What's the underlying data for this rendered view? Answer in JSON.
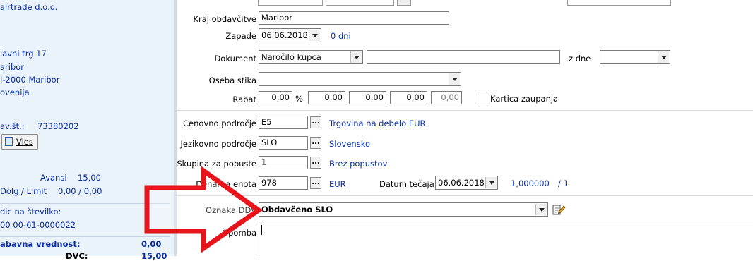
{
  "left": {
    "company": "airtrade d.o.o.",
    "street": "lavni trg 17",
    "city": "aribor",
    "postal": "I-2000  Maribor",
    "country": "ovenija",
    "tax_label": "av.št.:",
    "tax_value": "73380202",
    "vies_button": "Vies",
    "avansi_label": "Avansi",
    "avansi_value": "15,00",
    "dolg_label": "Dolg / Limit",
    "dolg_value": "0,00 / 0,00",
    "sklic_label": "dic na številko:",
    "sklic_value": "00 00-61-0000022",
    "davcna_label": "abavna vrednost:",
    "davcna_value": "0,00",
    "dvc_label": "DVC:",
    "dvc_value": "15,00"
  },
  "form": {
    "kraj_label": "Kraj obdavčitve",
    "kraj_value": "Maribor",
    "zapade_label": "Zapade",
    "zapade_value": "06.06.2018",
    "zapade_days": "0 dni",
    "dokument_label": "Dokument",
    "dokument_value": "Naročilo kupca",
    "zdne_label": "z dne",
    "oseba_label": "Oseba stika",
    "rabat_label": "Rabat",
    "rabat_values": [
      "0,00",
      "0,00",
      "0,00",
      "0,00",
      "0,00"
    ],
    "percent": "%",
    "kartica_label": "Kartica zaupanja",
    "cenovno_label": "Cenovno področje",
    "cenovno_code": "E5",
    "cenovno_desc": "Trgovina na debelo EUR",
    "jezik_label": "Jezikovno področje",
    "jezik_code": "SLO",
    "jezik_desc": "Slovensko",
    "skupina_label": "Skupina za popuste",
    "skupina_code": "1",
    "skupina_desc": "Brez popustov",
    "denarna_label": "Denarna enota",
    "denarna_code": "978",
    "denarna_desc": "EUR",
    "datum_tecaja_label": "Datum tečaja",
    "datum_tecaja_value": "06.06.2018",
    "tecaj_value": "1,000000",
    "tecaj_unit": "/ 1",
    "oznaka_label": "Oznaka DDV",
    "oznaka_value": "Obdavčeno SLO",
    "opomba_label": "Opomba",
    "ellipsis": "..."
  },
  "colors": {
    "link_blue": "#0b2fa8",
    "left_bg": "#eaf2fa",
    "arrow_red": "#e8141b"
  }
}
